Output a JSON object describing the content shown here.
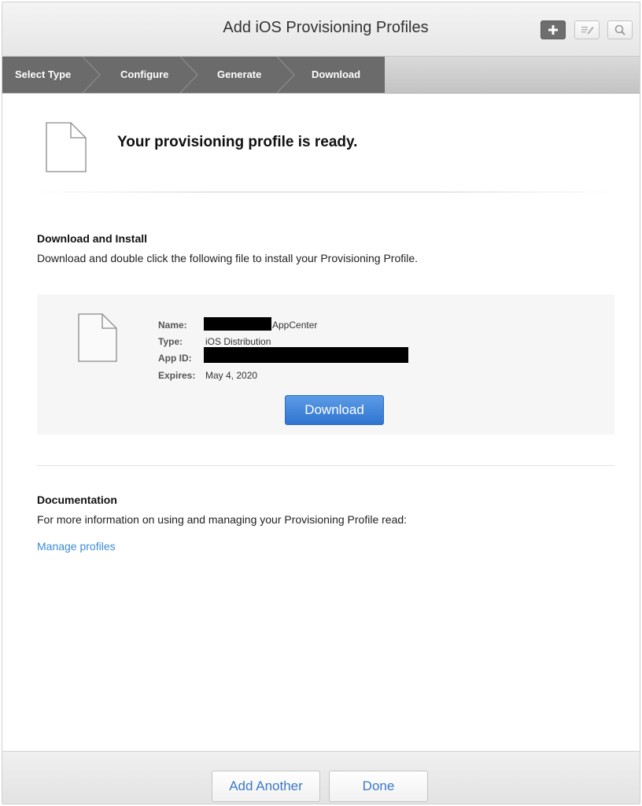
{
  "header": {
    "title": "Add iOS Provisioning Profiles",
    "buttons": [
      {
        "icon": "plus-icon"
      },
      {
        "icon": "edit-icon"
      },
      {
        "icon": "search-icon"
      }
    ]
  },
  "steps": [
    {
      "label": "Select Type"
    },
    {
      "label": "Configure"
    },
    {
      "label": "Generate"
    },
    {
      "label": "Download"
    }
  ],
  "ready": {
    "icon": "document-icon",
    "message": "Your provisioning profile is ready."
  },
  "download_section": {
    "title": "Download and Install",
    "description": "Download and double click the following file to install your Provisioning Profile.",
    "profile": {
      "icon": "document-icon",
      "name_label": "Name:",
      "name_value": "AppCenter",
      "type_label": "Type:",
      "type_value": "iOS Distribution",
      "app_id_label": "App ID:",
      "expires_label": "Expires:",
      "expires_value": "May 4, 2020"
    },
    "download_button": "Download"
  },
  "documentation": {
    "title": "Documentation",
    "description": "For more information on using and managing your Provisioning Profile read:",
    "link": "Manage profiles"
  },
  "footer": {
    "add_another": "Add Another",
    "done": "Done"
  },
  "colors": {
    "primary_button": "#2f74d0",
    "link": "#3b8bd6",
    "active_step_bar": "#6b6b6b"
  }
}
